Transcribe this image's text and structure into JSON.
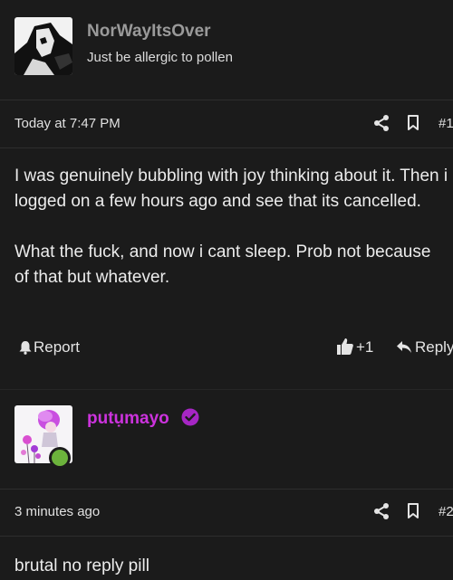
{
  "post1": {
    "username": "NorWayItsOver",
    "user_title": "Just be allergic to pollen",
    "timestamp": "Today at 7:47 PM",
    "post_number": "#1",
    "body": [
      "I was genuinely bubbling with joy thinking about it. Then i logged on a few hours ago and see that its cancelled.",
      "What the fuck, and now i cant sleep. Prob not because of that but whatever."
    ],
    "report_label": "Report",
    "like_count": "+1",
    "reply_label": "Reply"
  },
  "post2": {
    "username": "putụmayo",
    "username_color": "#cc33dd",
    "verified_color": "#a626c4",
    "online_color": "#6cb33c",
    "timestamp": "3 minutes ago",
    "post_number": "#2",
    "body": "brutal no reply pill"
  },
  "icons": [
    "share-icon",
    "bookmark-icon",
    "report-icon",
    "like-icon",
    "reply-icon",
    "verified-icon"
  ]
}
